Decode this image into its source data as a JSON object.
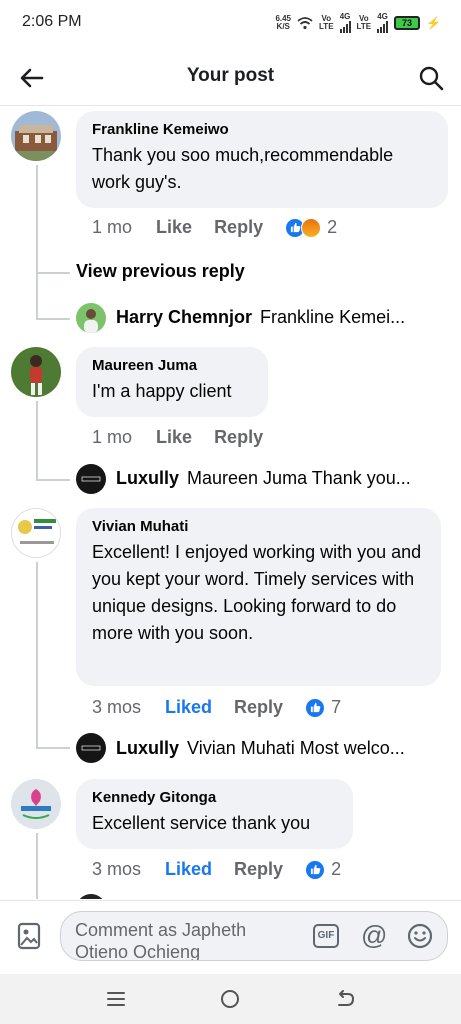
{
  "status_bar": {
    "time": "2:06 PM",
    "net_speed_value": "6.45",
    "net_speed_unit": "K/S",
    "sim1_label_top": "Vo",
    "sim1_label_bottom": "LTE",
    "sim1_gen": "4G",
    "sim2_label_top": "Vo",
    "sim2_label_bottom": "LTE",
    "sim2_gen": "4G",
    "battery": "73"
  },
  "header": {
    "title": "Your post"
  },
  "comments": [
    {
      "name": "Frankline Kemeiwo",
      "text": "Thank you soo much,recommendable work guy's.",
      "time": "1 mo",
      "like_label": "Like",
      "reply_label": "Reply",
      "reaction_count": "2",
      "view_previous": "View previous reply",
      "reply_preview": {
        "name": "Harry Chemnjor",
        "text": "Frankline Kemei..."
      }
    },
    {
      "name": "Maureen Juma",
      "text": "I'm a happy client",
      "time": "1 mo",
      "like_label": "Like",
      "reply_label": "Reply",
      "reply_preview": {
        "name": "Luxully",
        "text": "Maureen Juma Thank you..."
      }
    },
    {
      "name": "Vivian Muhati",
      "text": "Excellent! I enjoyed working with you and you kept your word. Timely services with unique designs. Looking forward to do more with you soon.",
      "time": "3 mos",
      "like_label": "Liked",
      "reply_label": "Reply",
      "reaction_count": "7",
      "reply_preview": {
        "name": "Luxully",
        "text": "Vivian Muhati Most welco..."
      }
    },
    {
      "name": "Kennedy Gitonga",
      "text": "Excellent service thank you",
      "time": "3 mos",
      "like_label": "Liked",
      "reply_label": "Reply",
      "reaction_count": "2"
    }
  ],
  "composer": {
    "placeholder": "Comment as Japheth Otieno Ochieng",
    "gif_label": "GIF",
    "at_label": "@"
  },
  "colors": {
    "accent": "#1877f2",
    "bubble": "#f0f2f5",
    "muted": "#65676b",
    "battery": "#3dc94a"
  },
  "icons": [
    "back-arrow-icon",
    "search-icon",
    "like-reaction-icon",
    "angry-reaction-icon",
    "photo-icon",
    "gif-icon",
    "at-icon",
    "emoji-icon",
    "menu-icon",
    "home-icon",
    "back-icon"
  ]
}
